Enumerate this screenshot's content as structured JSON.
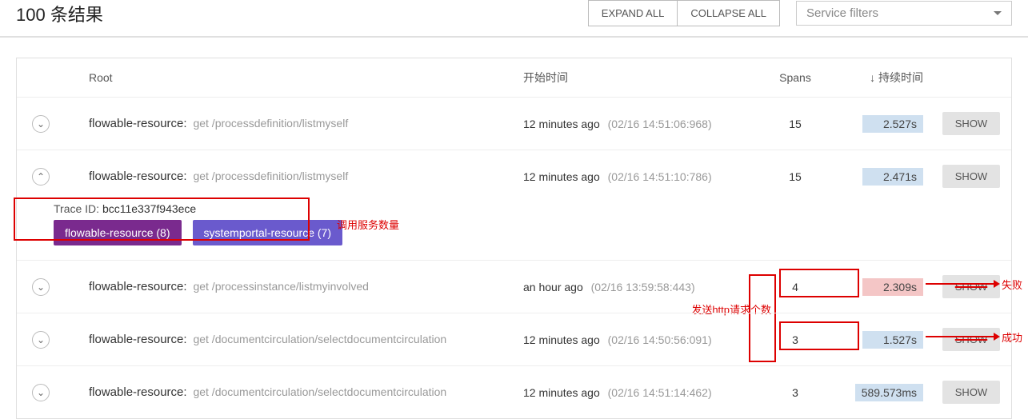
{
  "topbar": {
    "result_count": "100 条结果",
    "expand_all": "EXPAND ALL",
    "collapse_all": "COLLAPSE ALL",
    "service_filters_placeholder": "Service filters"
  },
  "headers": {
    "root": "Root",
    "start_time": "开始时间",
    "spans": "Spans",
    "duration": "持续时间"
  },
  "show_label": "SHOW",
  "traces": [
    {
      "expanded": false,
      "service": "flowable-resource:",
      "operation": "get /processdefinition/listmyself",
      "ago": "12 minutes ago",
      "ts": "(02/16 14:51:06:968)",
      "spans": "15",
      "duration": "2.527s",
      "dur_color": "blue"
    },
    {
      "expanded": true,
      "service": "flowable-resource:",
      "operation": "get /processdefinition/listmyself",
      "ago": "12 minutes ago",
      "ts": "(02/16 14:51:10:786)",
      "spans": "15",
      "duration": "2.471s",
      "dur_color": "blue",
      "detail": {
        "trace_id_label": "Trace ID:",
        "trace_id": "bcc11e337f943ece",
        "tags": [
          {
            "label": "flowable-resource (8)",
            "cls": "tag-purple-dark"
          },
          {
            "label": "systemportal-resource (7)",
            "cls": "tag-purple"
          }
        ]
      }
    },
    {
      "expanded": false,
      "service": "flowable-resource:",
      "operation": "get /processinstance/listmyinvolved",
      "ago": "an hour ago",
      "ts": "(02/16 13:59:58:443)",
      "spans": "4",
      "duration": "2.309s",
      "dur_color": "red",
      "strike_show": true
    },
    {
      "expanded": false,
      "service": "flowable-resource:",
      "operation": "get /documentcirculation/selectdocumentcirculation",
      "ago": "12 minutes ago",
      "ts": "(02/16 14:50:56:091)",
      "spans": "3",
      "duration": "1.527s",
      "dur_color": "blue",
      "strike_show": true
    },
    {
      "expanded": false,
      "service": "flowable-resource:",
      "operation": "get /documentcirculation/selectdocumentcirculation",
      "ago": "12 minutes ago",
      "ts": "(02/16 14:51:14:462)",
      "spans": "3",
      "duration": "589.573ms",
      "dur_color": "blue"
    }
  ],
  "annotations": {
    "call_service_count": "调用服务数量",
    "http_req_count": "发送http请求个数",
    "fail": "失败",
    "success": "成功"
  }
}
